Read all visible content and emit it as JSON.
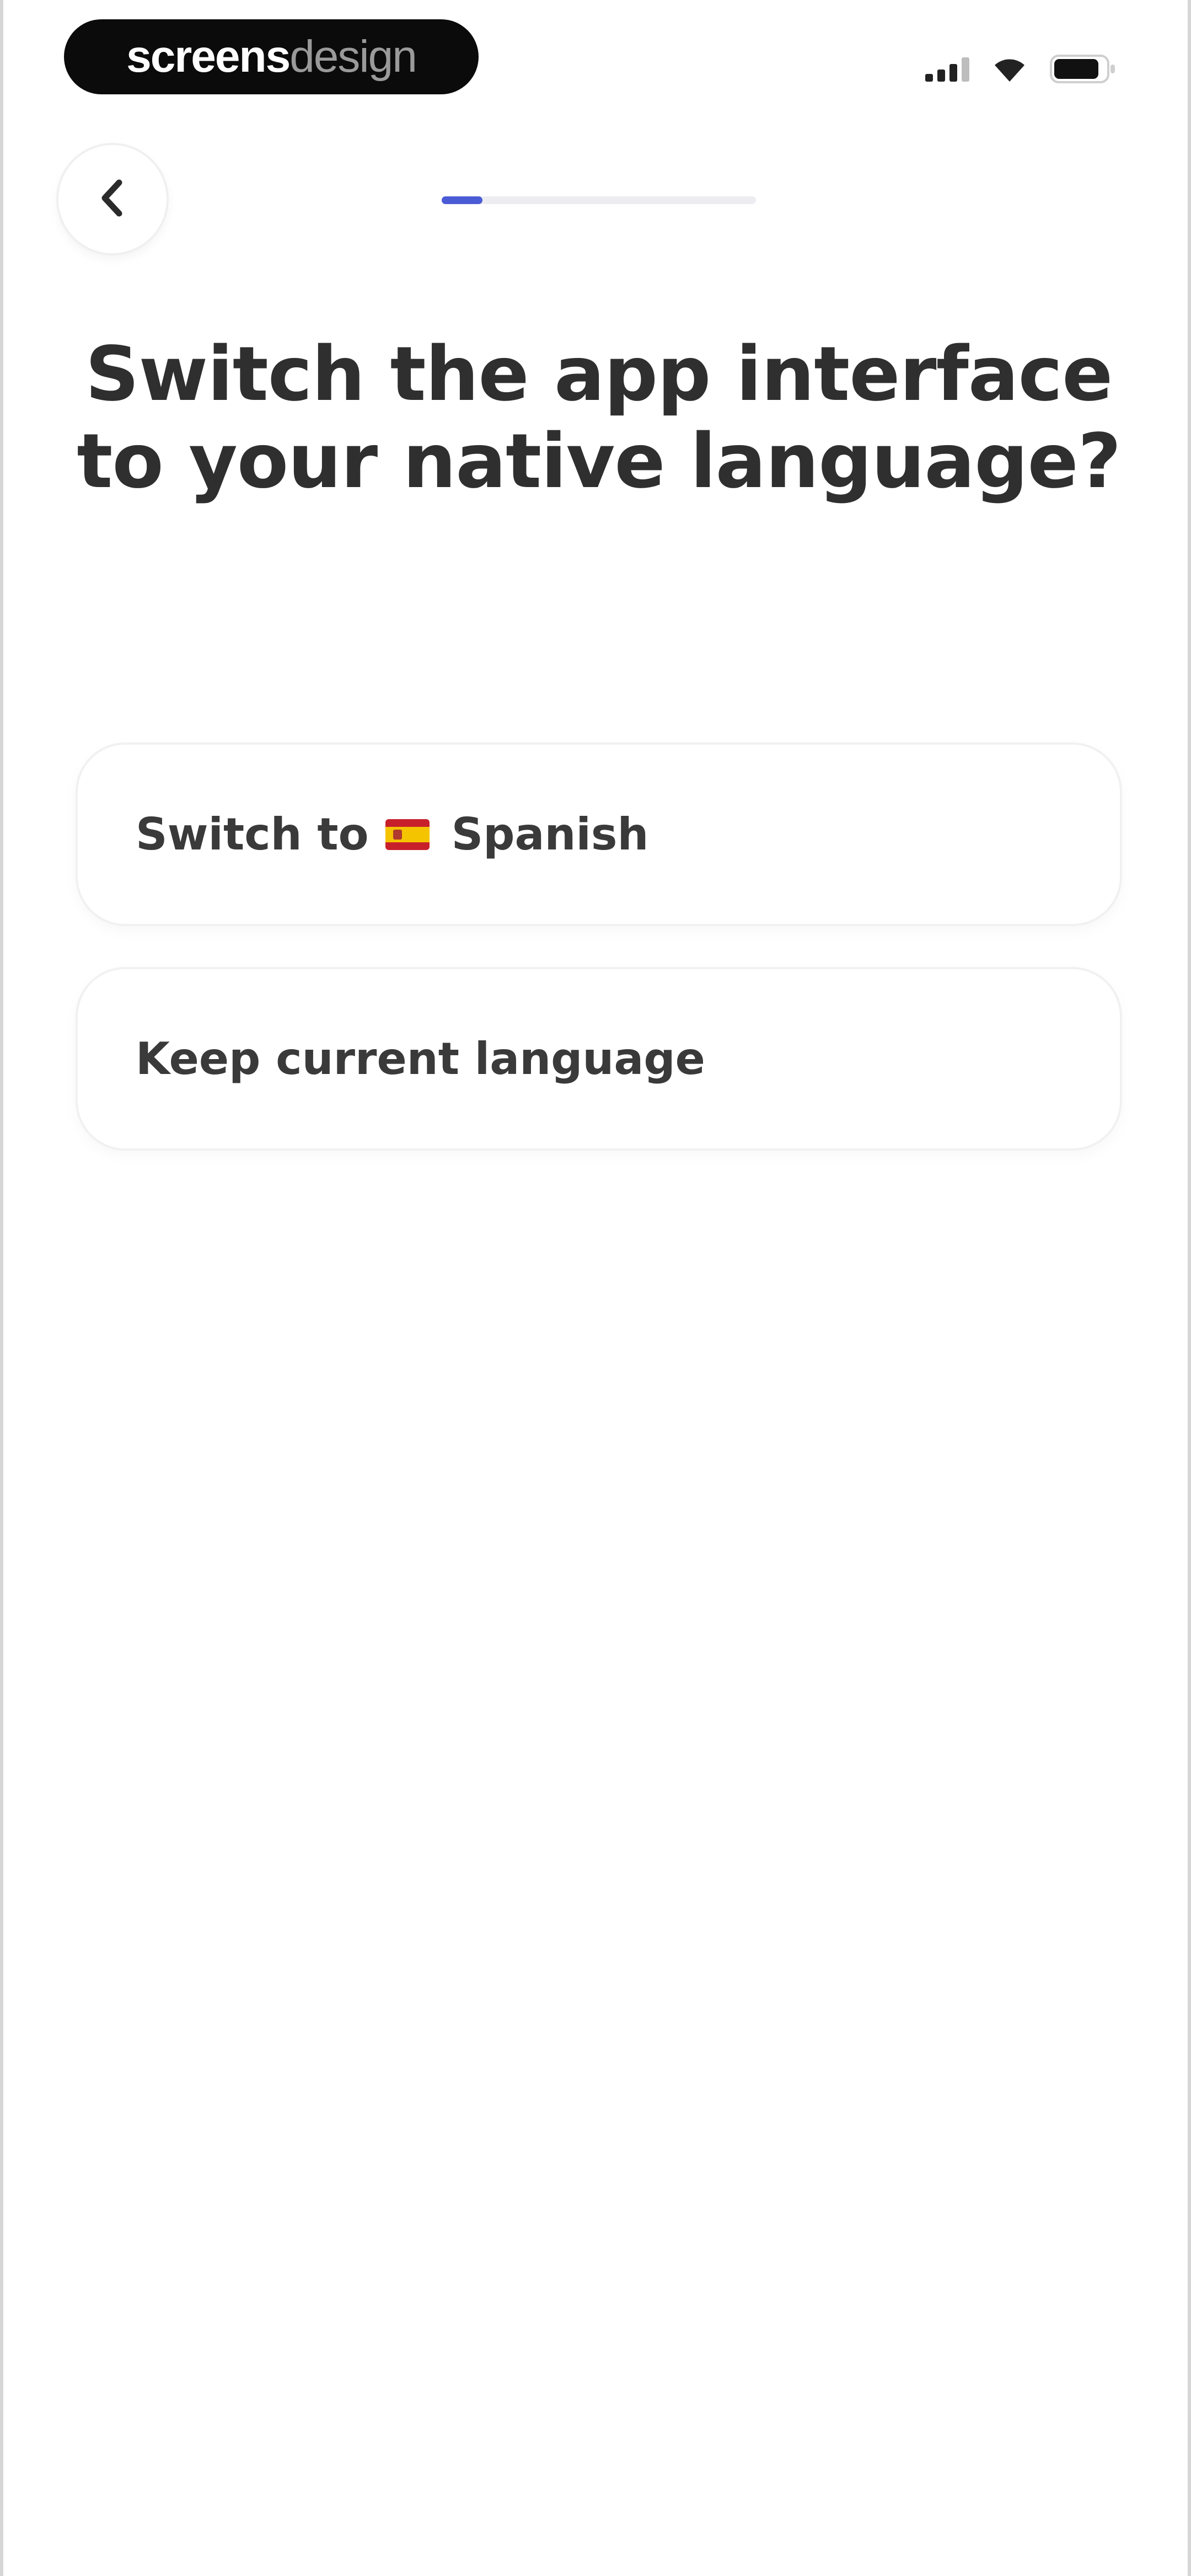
{
  "status_bar": {
    "brand_strong": "screens",
    "brand_light": "design",
    "icons": [
      "cellular-signal-icon",
      "wifi-icon",
      "battery-icon"
    ]
  },
  "header": {
    "back_icon": "chevron-left-icon",
    "progress_fraction": 0.13,
    "progress_color": "#4b5bd6"
  },
  "title": "Switch the app interface to your native language?",
  "options": [
    {
      "prefix": "Switch to",
      "flag": "spain-flag-icon",
      "language": "Spanish"
    },
    {
      "label": "Keep current language"
    }
  ]
}
